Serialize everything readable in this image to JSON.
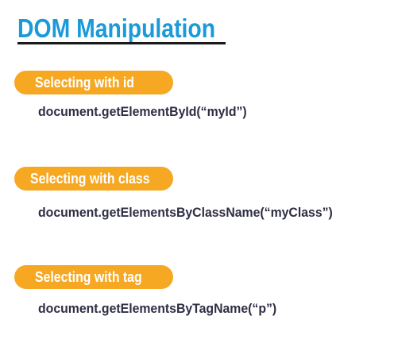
{
  "title": "DOM Manipulation",
  "sections": [
    {
      "label": "Selecting with id",
      "code": "document.getElementById(“myId”)"
    },
    {
      "label": "Selecting with class",
      "code": "document.getElementsByClassName(“myClass”)"
    },
    {
      "label": "Selecting with tag",
      "code": "document.getElementsByTagName(“p”)"
    }
  ],
  "colors": {
    "title": "#1a9ad8",
    "pill": "#f6a823",
    "code": "#2e2e44"
  }
}
